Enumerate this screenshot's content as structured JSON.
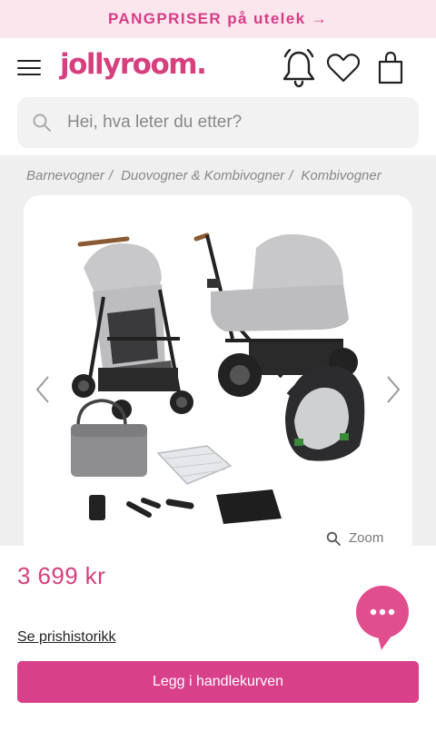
{
  "promo": {
    "text": "PANGPRISER på utelek →"
  },
  "header": {
    "logo": "jollyroom.",
    "icons": [
      "menu-icon",
      "bell-icon",
      "heart-icon",
      "shopping-bag-icon"
    ]
  },
  "search": {
    "placeholder": "Hei, hva leter du etter?",
    "value": ""
  },
  "breadcrumb": [
    {
      "label": "Barnevogner",
      "sep": "/"
    },
    {
      "label": "Duovogner & Kombivogner",
      "sep": "/"
    },
    {
      "label": "Kombivogner",
      "sep": ""
    }
  ],
  "gallery": {
    "zoom_label": "Zoom",
    "icons": [
      "chevron-left-icon",
      "chevron-right-icon",
      "zoom-icon"
    ]
  },
  "product": {
    "price": "3 699 kr",
    "price_history_link": "Se prishistorikk",
    "add_to_cart": "Legg i handlekurven"
  },
  "colors": {
    "brand_pink": "#d6407f",
    "promo_bg": "#fbe6ee",
    "cta_bg": "#d9408a",
    "chat_bg": "#e14e8e"
  }
}
